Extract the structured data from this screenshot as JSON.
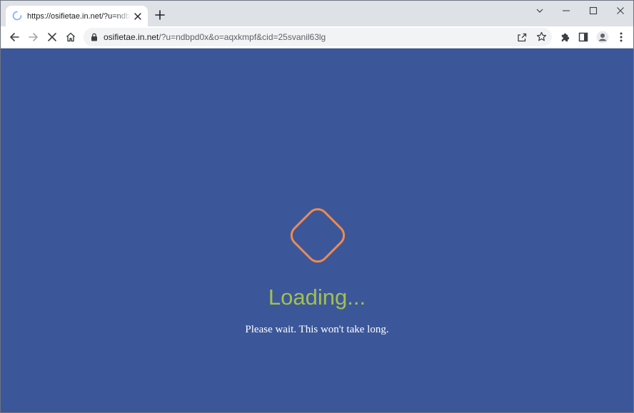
{
  "browser": {
    "tab": {
      "title": "https://osifietae.in.net/?u=ndbpd0x&o=aqxkmpf&cid=25svanil63lg"
    },
    "address_bar": {
      "host": "osifietae.in.net",
      "path": "/?u=ndbpd0x&o=aqxkmpf&cid=25svanil63lg"
    },
    "icons": {
      "tab_spinner": "loading-spinner-icon",
      "tab_close": "close-icon",
      "new_tab": "plus-icon",
      "tab_search": "chevron-down-icon",
      "minimize": "minimize-icon",
      "maximize": "maximize-icon",
      "close_window": "close-icon",
      "back": "arrow-left-icon",
      "forward": "arrow-right-icon",
      "stop": "stop-icon",
      "home": "home-icon",
      "lock": "lock-icon",
      "share": "share-icon",
      "bookmark": "star-icon",
      "extensions": "puzzle-icon",
      "side_panel": "side-panel-icon",
      "profile": "profile-icon",
      "menu": "kebab-menu-icon"
    }
  },
  "page": {
    "heading": "Loading...",
    "message": "Please wait. This won't take long.",
    "colors": {
      "background": "#3b5799",
      "heading": "#a4c04d",
      "loader": "#f0894f",
      "message": "#ffffff"
    }
  }
}
